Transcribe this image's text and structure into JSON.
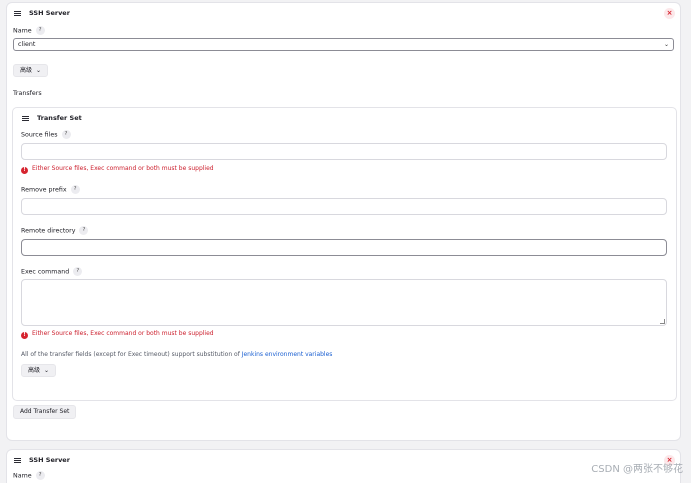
{
  "server1": {
    "title": "SSH Server",
    "close": "×",
    "name_label": "Name",
    "name_value": "client",
    "advanced_label": "高级",
    "transfers_label": "Transfers"
  },
  "transfer_set": {
    "title": "Transfer Set",
    "source_files_label": "Source files",
    "error_text": "Either Source files, Exec command or both must be supplied",
    "remove_prefix_label": "Remove prefix",
    "remote_directory_label": "Remote directory",
    "exec_command_label": "Exec command",
    "note_text": "All of the transfer fields (except for Exec timeout) support substitution of ",
    "note_link": "Jenkins environment variables",
    "advanced_label": "高级"
  },
  "add_transfer_set_label": "Add Transfer Set",
  "server2": {
    "title": "SSH Server",
    "close": "×",
    "name_label": "Name"
  },
  "help_glyph": "?",
  "watermark": "CSDN @两张不够花",
  "colors": {
    "error": "#cc1f2d",
    "link": "#1a5fd1",
    "close": "#d6242f"
  }
}
